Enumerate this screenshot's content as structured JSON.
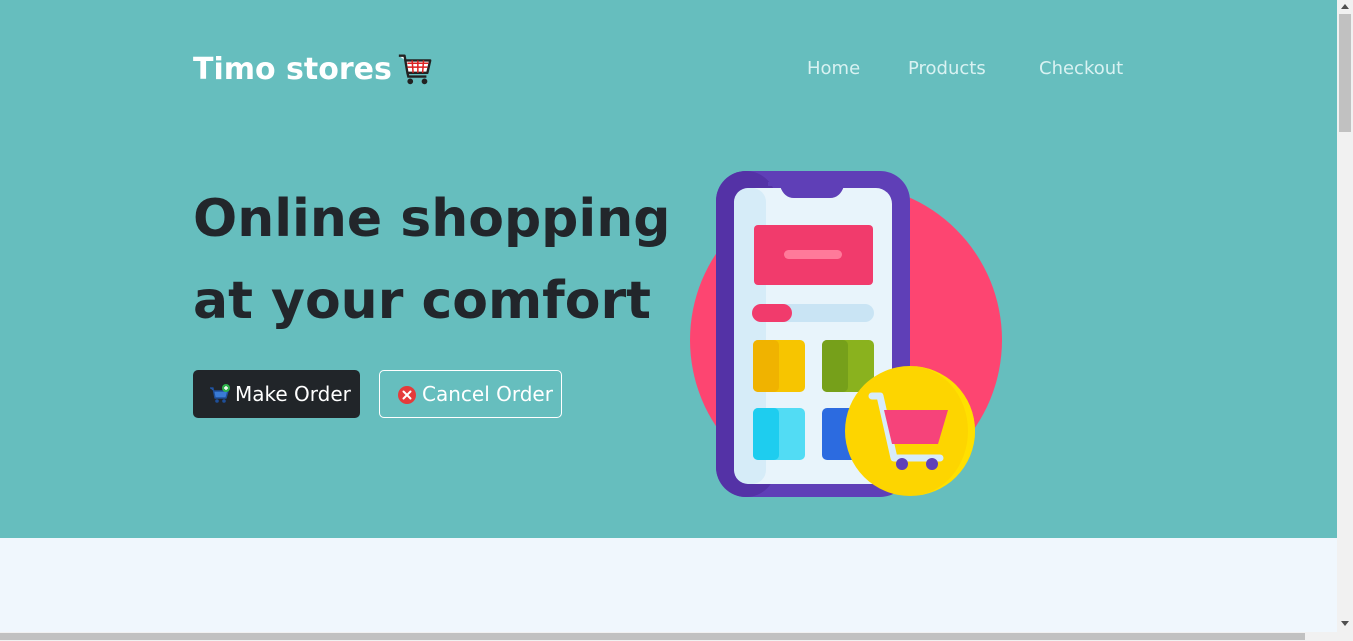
{
  "header": {
    "brand": "Timo stores",
    "nav": [
      "Home",
      "Products",
      "Checkout"
    ]
  },
  "hero": {
    "headline_line1": "Online shopping",
    "headline_line2": "at your comfort",
    "buttons": {
      "make_order": "Make Order",
      "cancel_order": "Cancel Order"
    },
    "icons": [
      "shopping-cart-icon",
      "cart-add-icon",
      "cancel-x-icon",
      "phone-shopping-illustration"
    ]
  },
  "colors": {
    "hero_bg": "#66bebe",
    "page_bg": "#f0f7fd",
    "dark": "#212529",
    "nav_text": "#d9f2f2"
  }
}
